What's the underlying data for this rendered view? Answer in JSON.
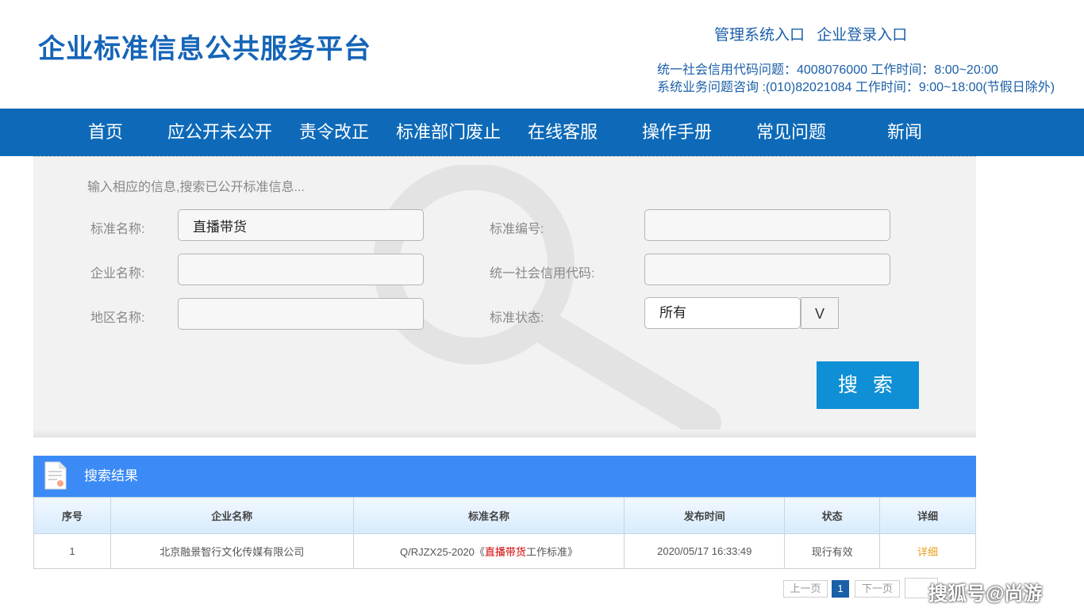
{
  "header": {
    "title": "企业标准信息公共服务平台",
    "links": [
      "管理系统入口",
      "企业登录入口"
    ],
    "contact_line1": "统一社会信用代码问题：4008076000 工作时间：8:00~20:00",
    "contact_line2": "系统业务问题咨询 :(010)82021084 工作时间：9:00~18:00(节假日除外)"
  },
  "nav": {
    "items": [
      "首页",
      "应公开未公开",
      "责令改正",
      "标准部门废止",
      "在线客服",
      "操作手册",
      "常见问题",
      "新闻"
    ]
  },
  "search": {
    "hint": "输入相应的信息,搜索已公开标准信息...",
    "std_name_label": "标准名称:",
    "std_name_value": "直播带货",
    "std_no_label": "标准编号:",
    "std_no_value": "",
    "company_label": "企业名称:",
    "company_value": "",
    "credit_label": "统一社会信用代码:",
    "credit_value": "",
    "region_label": "地区名称:",
    "region_value": "",
    "status_label": "标准状态:",
    "status_value": "所有",
    "status_arrow": "V",
    "button_label": "搜 索"
  },
  "results": {
    "title": "搜索结果",
    "columns": [
      "序号",
      "企业名称",
      "标准名称",
      "发布时间",
      "状态",
      "详细"
    ],
    "rows": [
      {
        "index": "1",
        "company": "北京融景智行文化传媒有限公司",
        "std_prefix": "Q/RJZX25-2020《",
        "std_highlight": "直播带货",
        "std_suffix": "工作标准》",
        "date": "2020/05/17 16:33:49",
        "status": "现行有效",
        "detail": "详细"
      }
    ]
  },
  "pager": {
    "prev": "上一页",
    "current": "1",
    "next": "下一页",
    "jump_value": ""
  },
  "watermark": "搜狐号@尚游",
  "colors": {
    "brand": "#1565b8",
    "nav_bg": "#0e6ab8",
    "search_button": "#0e8fd6",
    "results_bar": "#3b8af5",
    "highlight": "#d40000",
    "detail_link": "#e8a21c"
  }
}
